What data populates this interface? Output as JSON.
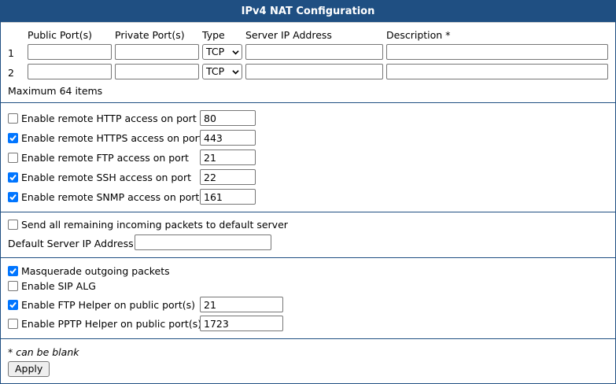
{
  "title": "IPv4 NAT Configuration",
  "table": {
    "headers": [
      "Public Port(s)",
      "Private Port(s)",
      "Type",
      "Server IP Address",
      "Description *"
    ],
    "rows": [
      {
        "index": "1",
        "public": "",
        "private": "",
        "type": "TCP",
        "server_ip": "",
        "description": ""
      },
      {
        "index": "2",
        "public": "",
        "private": "",
        "type": "TCP",
        "server_ip": "",
        "description": ""
      }
    ],
    "max_note": "Maximum 64 items"
  },
  "remote_access": [
    {
      "label": "Enable remote HTTP access on port",
      "checked": false,
      "port": "80"
    },
    {
      "label": "Enable remote HTTPS access on port",
      "checked": true,
      "port": "443"
    },
    {
      "label": "Enable remote FTP access on port",
      "checked": false,
      "port": "21"
    },
    {
      "label": "Enable remote SSH access on port",
      "checked": true,
      "port": "22"
    },
    {
      "label": "Enable remote SNMP access on port",
      "checked": true,
      "port": "161"
    }
  ],
  "default_server": {
    "send_label": "Send all remaining incoming packets to default server",
    "send_checked": false,
    "ip_label": "Default Server IP Address",
    "ip_value": ""
  },
  "misc": {
    "masquerade_label": "Masquerade outgoing packets",
    "masquerade_checked": true,
    "sip_label": "Enable SIP ALG",
    "sip_checked": false,
    "ftp_helper_label": "Enable FTP Helper on public port(s)",
    "ftp_helper_checked": true,
    "ftp_helper_value": "21",
    "pptp_helper_label": "Enable PPTP Helper on public port(s)",
    "pptp_helper_checked": false,
    "pptp_helper_value": "1723"
  },
  "footer": {
    "blank_note": "* can be blank",
    "apply_label": "Apply"
  },
  "colors": {
    "header": "#1f4f82",
    "checkbox": "#0075ff"
  }
}
